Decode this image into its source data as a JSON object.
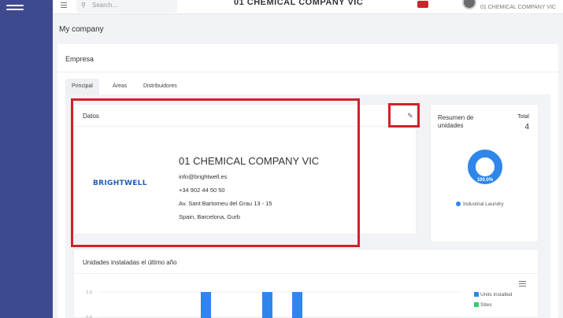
{
  "topbar": {
    "search_placeholder": "Search...",
    "company_title": "01 CHEMICAL COMPANY VIC",
    "user_company": "01 CHEMICAL COMPANY VIC"
  },
  "page": {
    "title": "My company"
  },
  "card": {
    "title": "Empresa"
  },
  "tabs": [
    {
      "label": "Principal",
      "active": true
    },
    {
      "label": "Áreas",
      "active": false
    },
    {
      "label": "Distribuidores",
      "active": false
    }
  ],
  "datos": {
    "title": "Datos",
    "logo_text": "BRIGHTWELL",
    "company_name": "01 CHEMICAL COMPANY VIC",
    "email": "info@brightwell.es",
    "phone": "+34 902 44 50 50",
    "address": "Av. Sant Bartomeu del Grau 13 - 15",
    "location": "Spain, Barcelona, Gurb"
  },
  "resumen": {
    "title": "Resumen de unidades",
    "total_label": "Total",
    "total_value": "4",
    "donut_label": "100.0%",
    "legend": "Industrial Laundry",
    "color": "#2f86ea"
  },
  "chart": {
    "title": "Unidades instaladas el último año"
  },
  "chart_data": {
    "type": "bar",
    "title": "Unidades instaladas el último año",
    "y_ticks": [
      "1.0",
      "0.8"
    ],
    "ylim": [
      0,
      1.0
    ],
    "series": [
      {
        "name": "Units installed",
        "color": "#2f86ea",
        "values": [
          1,
          1,
          1
        ]
      },
      {
        "name": "Sites",
        "color": "#2ecc71",
        "values": []
      }
    ],
    "legend_position": "top-right"
  }
}
